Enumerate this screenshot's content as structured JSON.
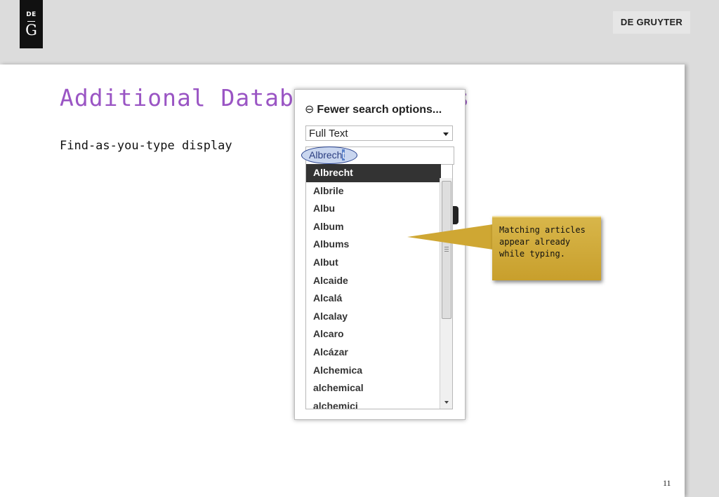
{
  "header": {
    "logo_top": "DE",
    "logo_letter": "G",
    "brand": "DE GRUYTER"
  },
  "slide": {
    "title": "Additional Database Features",
    "subtitle": "Find-as-you-type display",
    "page_number": "11"
  },
  "search_panel": {
    "toggle_label": "Fewer search options...",
    "field_select": "Full Text",
    "query_typed": "Albrech",
    "query_selected": "t",
    "suggestions": [
      "Albrecht",
      "Albrile",
      "Albu",
      "Album",
      "Albums",
      "Albut",
      "Alcaide",
      "Alcalá",
      "Alcalay",
      "Alcaro",
      "Alcázar",
      "Alchemica",
      "alchemical",
      "alchemici"
    ],
    "active_index": 0
  },
  "callout": {
    "text": "Matching articles appear already while typing."
  },
  "colors": {
    "title": "#9a55c4",
    "callout": "#d2ac3b",
    "highlight_border": "#243e8c"
  }
}
